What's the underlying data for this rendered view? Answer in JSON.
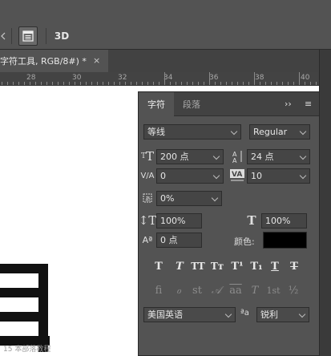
{
  "toolbar": {
    "threeD_label": "3D"
  },
  "document_tab": {
    "title": "字符工具, RGB/8#) *",
    "close": "×"
  },
  "ruler": {
    "ticks": [
      "28",
      "30",
      "32",
      "34",
      "36",
      "38",
      "40"
    ]
  },
  "canvas": {
    "watermark": "15 本部落教程"
  },
  "panel": {
    "tabs": [
      "字符",
      "段落"
    ],
    "collapse": "››",
    "menu": "≡",
    "font_family": "等线",
    "font_style": "Regular",
    "font_size": "200 点",
    "leading": "24 点",
    "kerning": "0",
    "tracking": "10",
    "tsume": "0%",
    "vertical_scale": "100%",
    "horizontal_scale": "100%",
    "baseline_shift": "0 点",
    "color_label": "颜色:",
    "text_color": "#000000",
    "style_buttons": [
      "T",
      "T",
      "TT",
      "Tт",
      "T¹",
      "T₁",
      "T",
      "T"
    ],
    "opentype_buttons": [
      "fi",
      "ℴ",
      "st",
      "𝒜",
      "aa",
      "T",
      "1st",
      "½"
    ],
    "language": "美国英语",
    "aa_icon_label": "ªa",
    "antialias": "锐利"
  }
}
